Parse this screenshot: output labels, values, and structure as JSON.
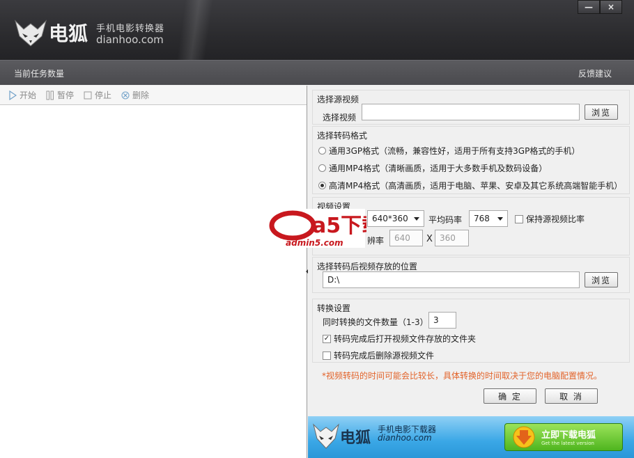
{
  "app": {
    "subtitle": "手机电影转换器",
    "site": "dianhoo.com",
    "logo_text": "电狐",
    "minimize_label": "—",
    "close_label": "×"
  },
  "subbar": {
    "task_count_label": "当前任务数量",
    "feedback_label": "反馈建议"
  },
  "toolbar": {
    "start": "开始",
    "pause": "暂停",
    "stop": "停止",
    "delete": "删除"
  },
  "source": {
    "group_title": "选择源视频",
    "label": "选择视频",
    "value": "",
    "browse": "浏览"
  },
  "format": {
    "group_title": "选择转码格式",
    "options": [
      {
        "label": "通用3GP格式（流畅，兼容性好，适用于所有支持3GP格式的手机）",
        "selected": false
      },
      {
        "label": "通用MP4格式（清晰画质，适用于大多数手机及数码设备）",
        "selected": false
      },
      {
        "label": "高清MP4格式（高清画质，适用于电脑、苹果、安卓及其它系统高端智能手机）",
        "selected": true
      }
    ]
  },
  "video": {
    "group_title": "视频设置",
    "resolution_value": "640*360",
    "bitrate_label": "平均码率",
    "bitrate_value": "768",
    "keep_ratio_label": "保持源视频比率",
    "keep_ratio_checked": false,
    "custom_res_label": "辨率",
    "width_value": "640",
    "x_label": "X",
    "height_value": "360"
  },
  "output": {
    "group_title": "选择转码后视频存放的位置",
    "path_value": "D:\\",
    "browse": "浏览"
  },
  "convert": {
    "group_title": "转换设置",
    "concurrent_label": "同时转换的文件数量（1-3）",
    "concurrent_value": "3",
    "open_folder_label": "转码完成后打开视频文件存放的文件夹",
    "open_folder_checked": true,
    "delete_source_label": "转码完成后删除源视频文件",
    "delete_source_checked": false,
    "note": "*视频转码的时间可能会比较长，具体转换的时间取决于您的电脑配置情况。"
  },
  "actions": {
    "ok": "确 定",
    "cancel": "取 消"
  },
  "banner": {
    "logo_text": "电狐",
    "subtitle": "手机电影下载器",
    "site": "dianhoo.com",
    "download_label": "立即下载电狐",
    "download_sub": "Get the latest version"
  },
  "watermark": {
    "brand": "a5下载",
    "url": "admin5.com"
  },
  "colors": {
    "note": "#e2632a",
    "banner_blue": "#3aa7e6",
    "download_green": "#4fb51f"
  }
}
